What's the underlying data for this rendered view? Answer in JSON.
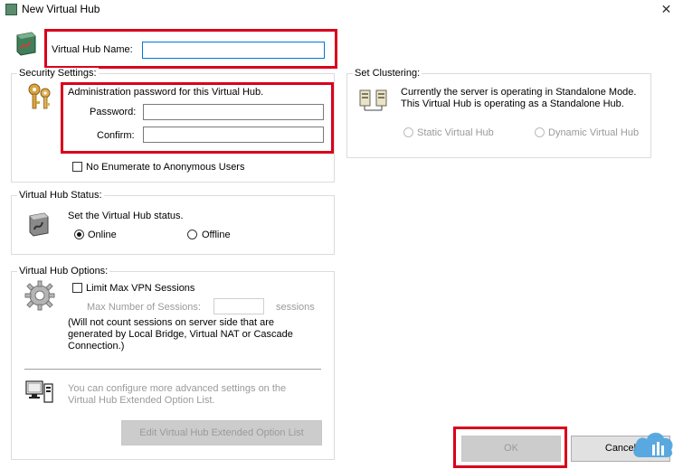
{
  "window": {
    "title": "New Virtual Hub",
    "close_glyph": "✕"
  },
  "hub_name": {
    "label": "Virtual Hub Name:",
    "value": ""
  },
  "security": {
    "group_label": "Security Settings:",
    "description": "Administration password for this Virtual Hub.",
    "password_label": "Password:",
    "password_value": "",
    "confirm_label": "Confirm:",
    "confirm_value": "",
    "no_enum_label": "No Enumerate to Anonymous Users"
  },
  "clustering": {
    "group_label": "Set Clustering:",
    "line1": "Currently the server is operating in Standalone Mode.",
    "line2": "This Virtual Hub is operating as a Standalone Hub.",
    "static_label": "Static Virtual Hub",
    "dynamic_label": "Dynamic Virtual Hub"
  },
  "status": {
    "group_label": "Virtual Hub Status:",
    "description": "Set the Virtual Hub status.",
    "online_label": "Online",
    "offline_label": "Offline",
    "selected": "Online"
  },
  "options": {
    "group_label": "Virtual Hub Options:",
    "limit_label": "Limit Max VPN Sessions",
    "max_sessions_label": "Max Number of Sessions:",
    "sessions_unit": "sessions",
    "note_line1": "(Will not count sessions on server side that are",
    "note_line2": "generated by Local Bridge, Virtual NAT or Cascade",
    "note_line3": "Connection.)",
    "advanced_line1": "You can configure more advanced settings on the",
    "advanced_line2": "Virtual Hub Extended Option List.",
    "edit_button": "Edit Virtual Hub Extended Option List"
  },
  "footer": {
    "ok_label": "OK",
    "cancel_label": "Cancel"
  },
  "colors": {
    "highlight_red": "#d9001b",
    "focus_blue": "#0078d7",
    "disabled_gray": "#9a9a9a"
  },
  "icons": [
    "hub-icon",
    "keys-icon",
    "cluster-icon",
    "status-hub-icon",
    "gear-icon",
    "computer-icon",
    "cloud-logo-icon"
  ]
}
